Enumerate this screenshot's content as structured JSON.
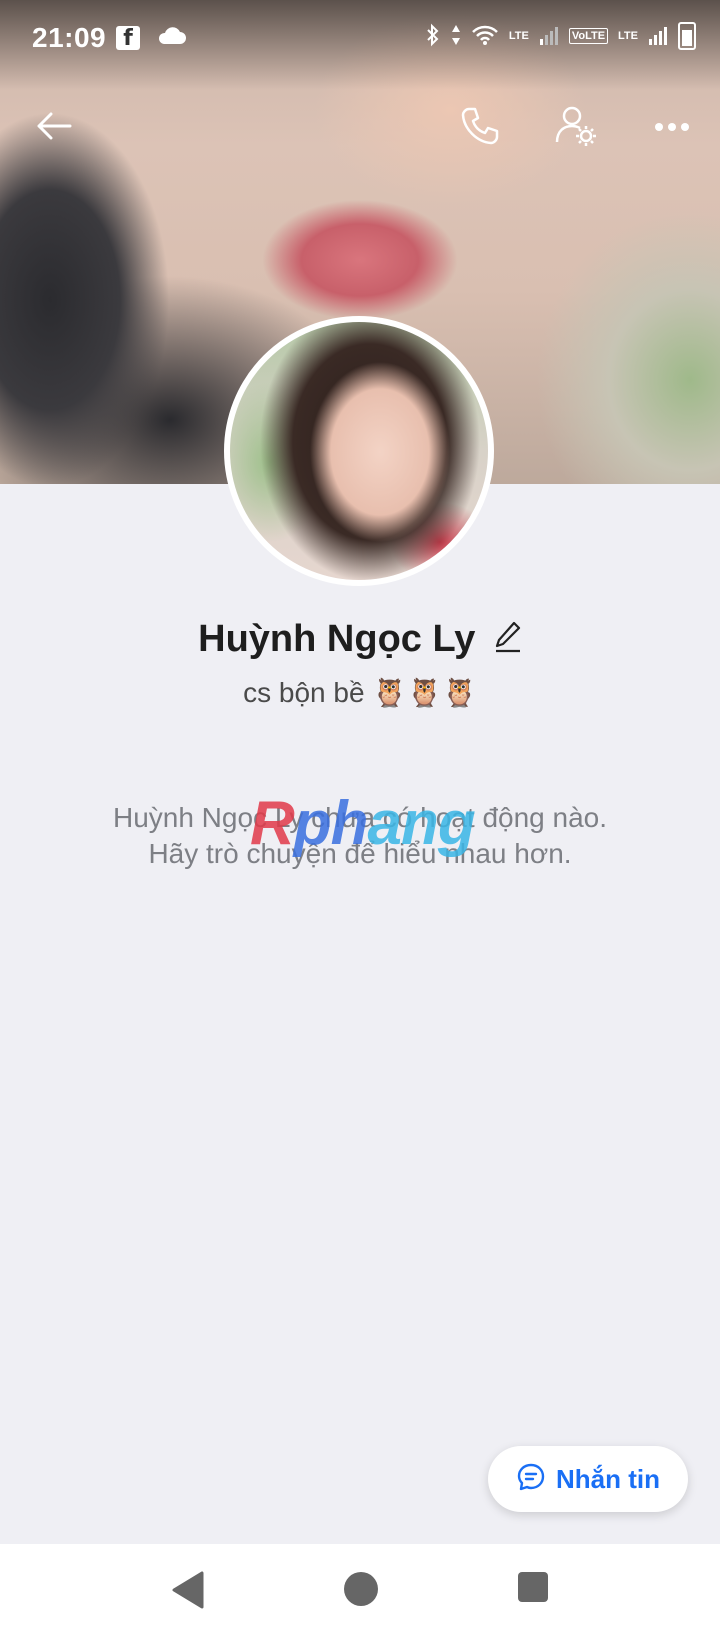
{
  "status_bar": {
    "time": "21:09",
    "lte1": "LTE",
    "volte": "VoLTE",
    "lte2": "LTE"
  },
  "profile": {
    "name": "Huỳnh Ngọc Ly",
    "bio": "cs bộn bề 🦉🦉🦉"
  },
  "empty_state": {
    "line1": "Huỳnh Ngọc Ly chưa có hoạt động nào.",
    "line2": "Hãy trò chuyện để hiểu nhau hơn."
  },
  "watermark": {
    "part1": "R",
    "part2": "ph",
    "part3": "ang"
  },
  "message_button": {
    "label": "Nhắn tin"
  },
  "icons": [
    "back-arrow-icon",
    "phone-icon",
    "user-settings-icon",
    "more-icon",
    "pencil-icon",
    "chat-bubble-icon",
    "nav-back-icon",
    "nav-home-icon",
    "nav-recents-icon"
  ],
  "colors": {
    "accent": "#1a6ff5",
    "background": "#efeff4"
  }
}
